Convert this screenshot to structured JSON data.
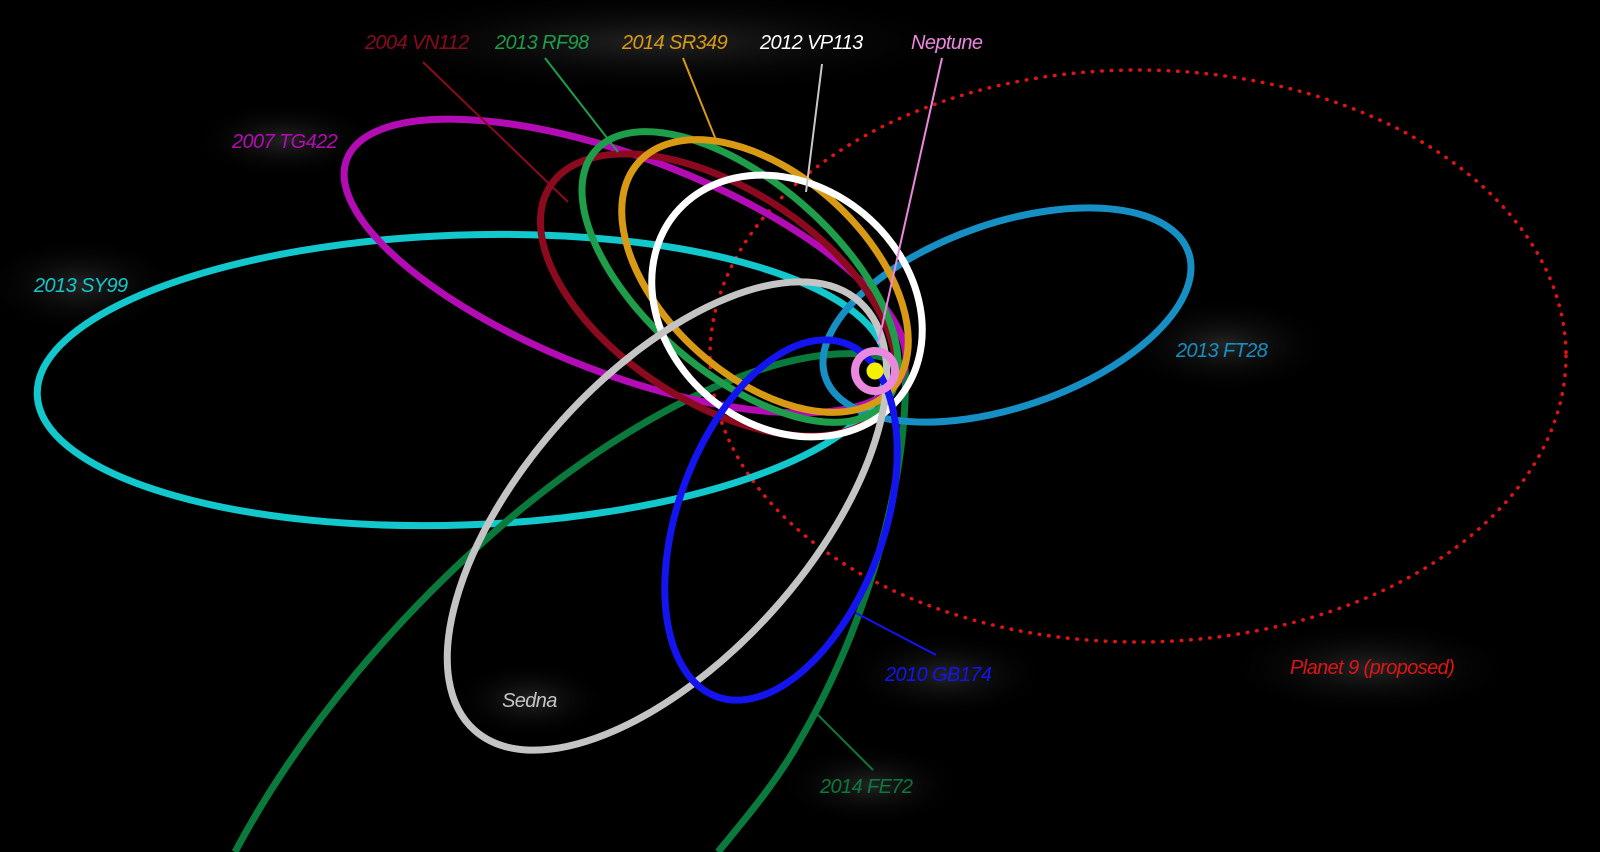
{
  "background": "#000000",
  "labels": {
    "vn112": "2004 VN112",
    "rf98": "2013 RF98",
    "sr349": "2014 SR349",
    "vp113": "2012 VP113",
    "neptune": "Neptune",
    "tg422": "2007 TG422",
    "sy99": "2013 SY99",
    "ft28": "2013 FT28",
    "gb174": "2010 GB174",
    "planet9": "Planet 9 (proposed)",
    "sedna": "Sedna",
    "fe72": "2014 FE72"
  },
  "colors": {
    "vn112": "#8b0a1e",
    "rf98": "#1e9e4a",
    "sr349": "#d89a14",
    "vp113": "#ffffff",
    "neptune": "#ea88e0",
    "tg422": "#b40cb4",
    "sy99": "#12c8cc",
    "ft28": "#1690c4",
    "gb174": "#1414f0",
    "planet9": "#e01414",
    "sedna": "#c4c4c4",
    "fe72": "#0a7a3c",
    "sun": "#f4f000"
  }
}
